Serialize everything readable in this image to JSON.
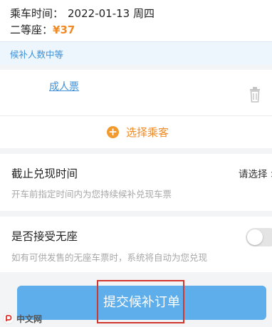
{
  "trip": {
    "time_label": "乘车时间：",
    "date": "2022-01-13 周四",
    "seat_label": "二等座：",
    "price": "¥37"
  },
  "notice": {
    "text": "候补人数中等"
  },
  "passenger": {
    "adult_ticket_link": "成人票",
    "delete_icon": "trash-icon",
    "add_icon": "plus-circle-icon",
    "select_label": "选择乘客"
  },
  "deadline": {
    "title": "截止兑现时间",
    "select_text": "请选择 >",
    "description": "开车前指定时间内为您持续候补兑现车票"
  },
  "no_seat": {
    "title": "是否接受无座",
    "toggle_on": false,
    "description": "如有可供发售的无座车票时，系统将自动为您兑现"
  },
  "submit": {
    "label": "提交候补订单"
  },
  "watermark": {
    "text": "中文网",
    "icon": "php-logo-icon"
  },
  "colors": {
    "accent_blue": "#5daeea",
    "link_blue": "#3d90d8",
    "orange": "#f08a24",
    "highlight_red": "#d0372f"
  }
}
